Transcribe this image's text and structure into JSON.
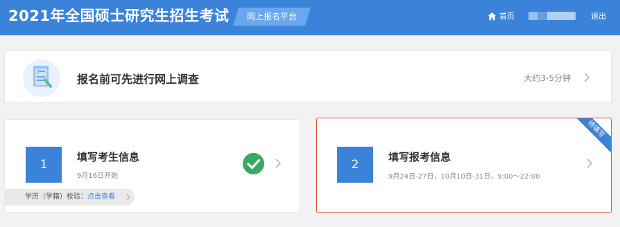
{
  "header": {
    "title": "2021年全国硕士研究生招生考试",
    "badge": "网上报名平台",
    "home_label": "首页",
    "logout_label": "退出",
    "home_icon": "home-icon"
  },
  "survey": {
    "text": "报名前可先进行网上调查",
    "time": "大约3-5分钟",
    "icon": "survey-document-icon"
  },
  "steps": [
    {
      "number": "1",
      "title": "填写考生信息",
      "subtitle": "9月16日开始",
      "status_icon": "check-circle-icon",
      "verify_label": "学历（学籍）校验：",
      "verify_link": "点击查看"
    },
    {
      "number": "2",
      "title": "填写报考信息",
      "subtitle": "9月24日-27日，10月10日-31日，9:00～22:00",
      "ribbon": "待填写"
    }
  ],
  "colors": {
    "header_bg": "#3b83d8",
    "accent": "#3b83d8",
    "check_green": "#36a964",
    "highlight_border": "#e34a33"
  }
}
